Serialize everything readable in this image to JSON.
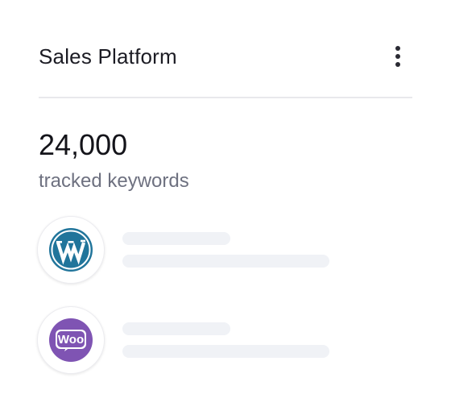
{
  "header": {
    "title": "Sales Platform",
    "menu_icon": "more-vertical-icon"
  },
  "stat": {
    "value": "24,000",
    "label": "tracked keywords"
  },
  "platforms": [
    {
      "icon": "wordpress-icon",
      "brand_color": "#21759b"
    },
    {
      "icon": "woocommerce-icon",
      "brand_color": "#7f54b3",
      "logo_text": "Woo"
    }
  ],
  "colors": {
    "text_primary": "#1c1c24",
    "text_secondary": "#6e7180",
    "skeleton": "#f0f2f6",
    "divider": "#e8e8ec"
  }
}
